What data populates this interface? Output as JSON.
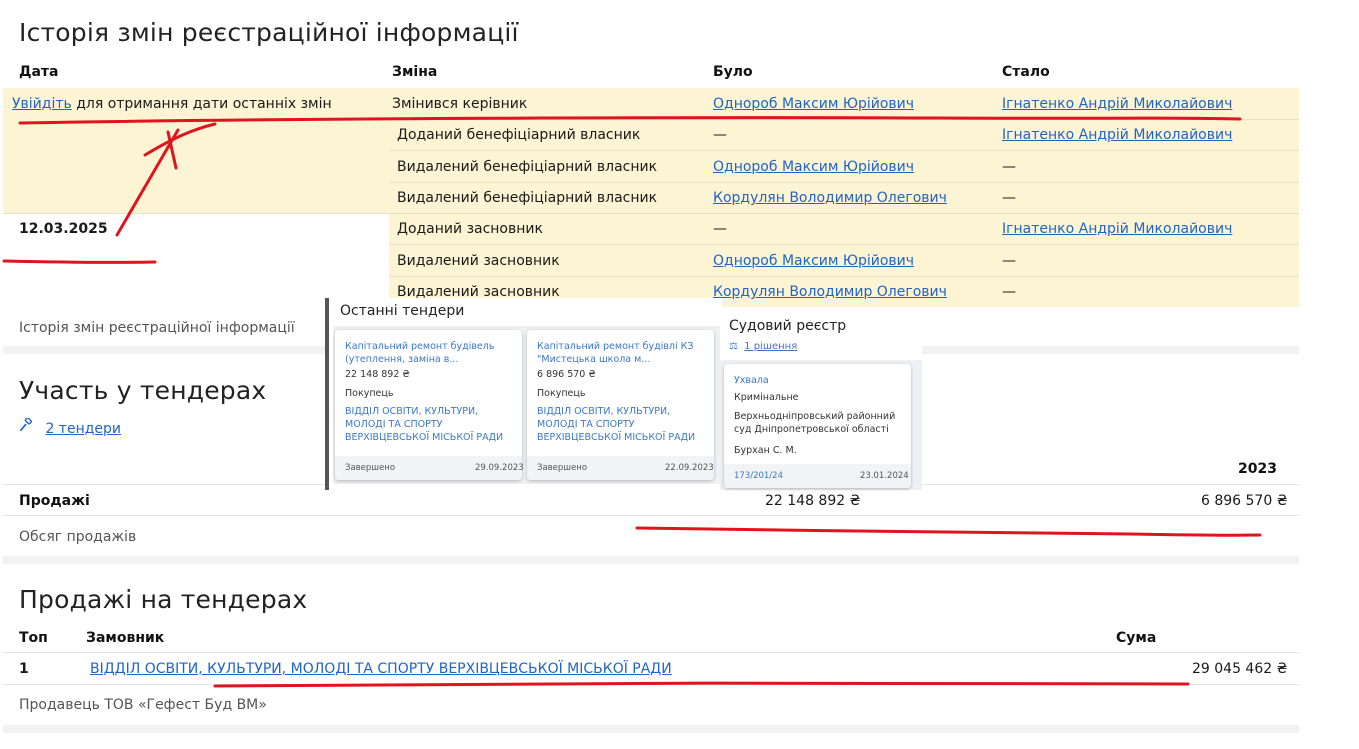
{
  "history": {
    "title": "Історія змін реєстраційної інформації",
    "columns": [
      "Дата",
      "Зміна",
      "Було",
      "Стало"
    ],
    "login_link": "Увійдіть",
    "login_rest": " для отримання дати останніх змін",
    "date": "12.03.2025",
    "rows": [
      {
        "change": "Змінився керівник",
        "was": "Однороб Максим Юрійович",
        "became": "Ігнатенко Андрій Миколайович"
      },
      {
        "change": "Доданий бенефіціарний власник",
        "was": "—",
        "became": "Ігнатенко Андрій Миколайович"
      },
      {
        "change": "Видалений бенефіціарний власник",
        "was": "Однороб Максим Юрійович",
        "became": "—"
      },
      {
        "change": "Видалений бенефіціарний власник",
        "was": "Кордулян Володимир Олегович",
        "became": "—"
      },
      {
        "change": "Доданий засновник",
        "was": "—",
        "became": "Ігнатенко Андрій Миколайович"
      },
      {
        "change": "Видалений засновник",
        "was": "Однороб Максим Юрійович",
        "became": "—"
      },
      {
        "change": "Видалений засновник",
        "was": "Кордулян Володимир Олегович",
        "became": "—"
      }
    ],
    "caption": "Історія змін реєстраційної інформації"
  },
  "tenders_section": {
    "title": "Участь у тендерах",
    "link": "2 тендери",
    "year": "2023",
    "sales_label": "Продажі",
    "sales_value_1": "22 148 892 ₴",
    "sales_value_2": "6 896 570 ₴",
    "caption": "Обсяг продажів"
  },
  "overlay_tenders": {
    "title": "Останні тендери",
    "cards": [
      {
        "link": "Капітальний ремонт будівель (утеплення, заміна в...",
        "amount": "22 148 892 ₴",
        "role": "Покупець",
        "buyer": "ВІДДІЛ ОСВІТИ, КУЛЬТУРИ, МОЛОДІ ТА СПОРТУ ВЕРХІВЦЕВСЬКОЇ МІСЬКОЇ РАДИ",
        "status": "Завершено",
        "date": "29.09.2023"
      },
      {
        "link": "Капітальний ремонт будівлі КЗ \"Мистецька школа м...",
        "amount": "6 896 570 ₴",
        "role": "Покупець",
        "buyer": "ВІДДІЛ ОСВІТИ, КУЛЬТУРИ, МОЛОДІ ТА СПОРТУ ВЕРХІВЦЕВСЬКОЇ МІСЬКОЇ РАДИ",
        "status": "Завершено",
        "date": "22.09.2023"
      }
    ]
  },
  "overlay_court": {
    "title": "Судовий реєстр",
    "link": "1 рішення",
    "card": {
      "type": "Ухвала",
      "category": "Кримінальне",
      "court": "Верхньодніпровський районний суд Дніпропетровської області",
      "judge": "Бурхан С. М.",
      "case": "173/201/24",
      "date": "23.01.2024"
    }
  },
  "tender_sales": {
    "title": "Продажі на тендерах",
    "columns": [
      "Топ",
      "Замовник",
      "Сума"
    ],
    "rows": [
      {
        "rank": "1",
        "customer": "ВІДДІЛ ОСВІТИ, КУЛЬТУРИ, МОЛОДІ ТА СПОРТУ ВЕРХІВЦЕВСЬКОЇ МІСЬКОЇ РАДИ",
        "amount": "29 045 462 ₴"
      }
    ],
    "caption": "Продавець ТОВ «Гефест Буд ВМ»"
  },
  "colors": {
    "highlight": "#fdf4d3",
    "link": "#1f64c8",
    "annotation": "#e0141e"
  }
}
